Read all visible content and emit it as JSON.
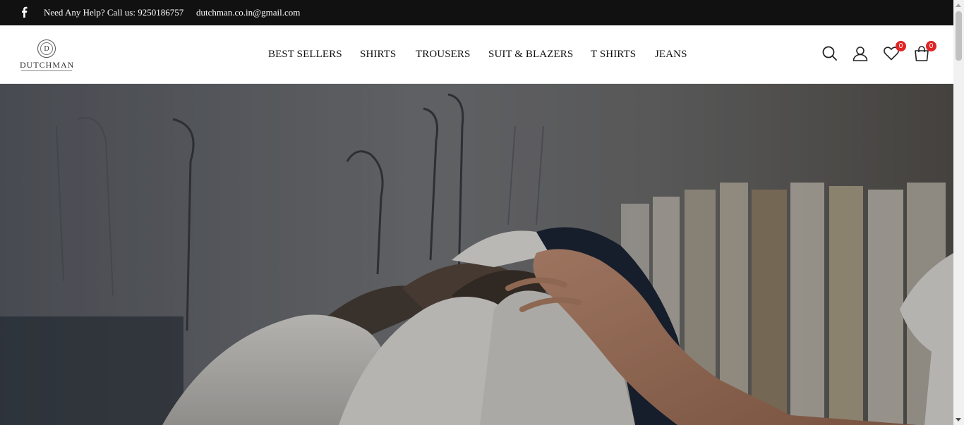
{
  "topbar": {
    "facebook_icon": "facebook-icon",
    "help_text": "Need Any Help? Call us: 9250186757",
    "email": "dutchman.co.in@gmail.com"
  },
  "logo": {
    "emblem_letter": "D",
    "brand": "DUTCHMAN"
  },
  "nav": {
    "items": [
      {
        "label": "BEST SELLERS"
      },
      {
        "label": "SHIRTS"
      },
      {
        "label": "TROUSERS"
      },
      {
        "label": "SUIT & BLAZERS"
      },
      {
        "label": "T SHIRTS"
      },
      {
        "label": "JEANS"
      }
    ]
  },
  "header_icons": {
    "search": "search-icon",
    "account": "user-icon",
    "wishlist": "heart-icon",
    "wishlist_count": "0",
    "cart": "bag-icon",
    "cart_count": "0"
  },
  "colors": {
    "topbar_bg": "#111111",
    "badge": "#e02424",
    "hero_overlay": "#00000066"
  }
}
